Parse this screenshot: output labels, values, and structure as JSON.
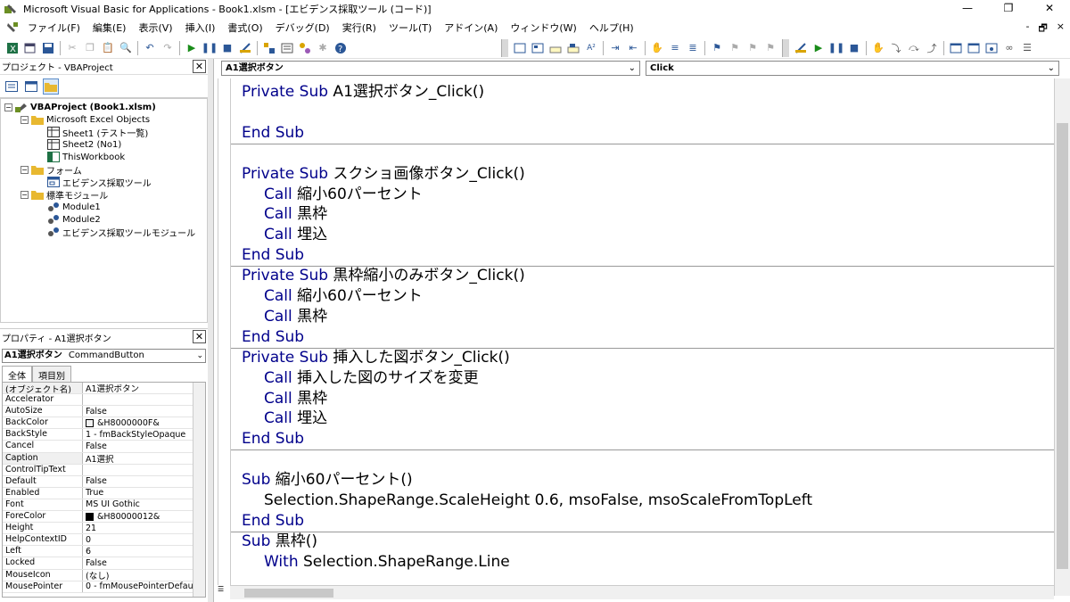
{
  "window": {
    "title": "Microsoft Visual Basic for Applications - Book1.xlsm - [エビデンス採取ツール (コード)]",
    "controls": [
      "—",
      "❐",
      "✕"
    ]
  },
  "menubar": {
    "items": [
      "ファイル(F)",
      "編集(E)",
      "表示(V)",
      "挿入(I)",
      "書式(O)",
      "デバッグ(D)",
      "実行(R)",
      "ツール(T)",
      "アドイン(A)",
      "ウィンドウ(W)",
      "ヘルプ(H)"
    ],
    "mdi_controls": [
      "-",
      "🗗",
      "×"
    ]
  },
  "project_pane": {
    "title": "プロジェクト - VBAProject",
    "tree": [
      {
        "label": "VBAProject (Book1.xlsm)",
        "level": 0,
        "expander": "−",
        "icon": "vba-project-icon",
        "bold": true
      },
      {
        "label": "Microsoft Excel Objects",
        "level": 1,
        "expander": "−",
        "icon": "folder-icon"
      },
      {
        "label": "Sheet1 (テスト一覧)",
        "level": 2,
        "icon": "sheet-icon"
      },
      {
        "label": "Sheet2 (No1)",
        "level": 2,
        "icon": "sheet-icon"
      },
      {
        "label": "ThisWorkbook",
        "level": 2,
        "icon": "workbook-icon"
      },
      {
        "label": "フォーム",
        "level": 1,
        "expander": "−",
        "icon": "folder-icon"
      },
      {
        "label": "エビデンス採取ツール",
        "level": 2,
        "icon": "userform-icon"
      },
      {
        "label": "標準モジュール",
        "level": 1,
        "expander": "−",
        "icon": "folder-icon"
      },
      {
        "label": "Module1",
        "level": 2,
        "icon": "module-icon"
      },
      {
        "label": "Module2",
        "level": 2,
        "icon": "module-icon"
      },
      {
        "label": "エビデンス採取ツールモジュール",
        "level": 2,
        "icon": "module-icon"
      }
    ]
  },
  "properties_pane": {
    "title": "プロパティ - A1選択ボタン",
    "object_select": {
      "name": "A1選択ボタン",
      "type": "CommandButton"
    },
    "tabs": [
      "全体",
      "項目別"
    ],
    "rows": [
      {
        "name": "(オブジェクト名)",
        "value": "A1選択ボタン"
      },
      {
        "name": "Accelerator",
        "value": ""
      },
      {
        "name": "AutoSize",
        "value": "False"
      },
      {
        "name": "BackColor",
        "value": "&H8000000F&",
        "swatch": "#f0f0f0"
      },
      {
        "name": "BackStyle",
        "value": "1 - fmBackStyleOpaque"
      },
      {
        "name": "Cancel",
        "value": "False"
      },
      {
        "name": "Caption",
        "value": "A1選択"
      },
      {
        "name": "ControlTipText",
        "value": ""
      },
      {
        "name": "Default",
        "value": "False"
      },
      {
        "name": "Enabled",
        "value": "True"
      },
      {
        "name": "Font",
        "value": "MS UI Gothic"
      },
      {
        "name": "ForeColor",
        "value": "&H80000012&",
        "swatch": "#000000"
      },
      {
        "name": "Height",
        "value": "21"
      },
      {
        "name": "HelpContextID",
        "value": "0"
      },
      {
        "name": "Left",
        "value": "6"
      },
      {
        "name": "Locked",
        "value": "False"
      },
      {
        "name": "MouseIcon",
        "value": "(なし)"
      },
      {
        "name": "MousePointer",
        "value": "0 - fmMousePointerDefau"
      }
    ]
  },
  "code_window": {
    "object_combo": "A1選択ボタン",
    "procedure_combo": "Click",
    "lines": [
      {
        "kw": "Private Sub",
        "text": " A1選択ボタン_Click()",
        "indent": 0
      },
      {
        "kw": "",
        "text": "",
        "indent": 0
      },
      {
        "kw": "End Sub",
        "text": "",
        "indent": 0,
        "sep_after": true
      },
      {
        "kw": "",
        "text": "",
        "indent": 0
      },
      {
        "kw": "Private Sub",
        "text": " スクショ画像ボタン_Click()",
        "indent": 0
      },
      {
        "kw": "Call",
        "text": " 縮小60パーセント",
        "indent": 1
      },
      {
        "kw": "Call",
        "text": " 黒枠",
        "indent": 1
      },
      {
        "kw": "Call",
        "text": " 埋込",
        "indent": 1
      },
      {
        "kw": "End Sub",
        "text": "",
        "indent": 0,
        "sep_after": true
      },
      {
        "kw": "Private Sub",
        "text": " 黒枠縮小のみボタン_Click()",
        "indent": 0
      },
      {
        "kw": "Call",
        "text": " 縮小60パーセント",
        "indent": 1
      },
      {
        "kw": "Call",
        "text": " 黒枠",
        "indent": 1
      },
      {
        "kw": "End Sub",
        "text": "",
        "indent": 0,
        "sep_after": true
      },
      {
        "kw": "Private Sub",
        "text": " 挿入した図ボタン_Click()",
        "indent": 0
      },
      {
        "kw": "Call",
        "text": " 挿入した図のサイズを変更",
        "indent": 1
      },
      {
        "kw": "Call",
        "text": " 黒枠",
        "indent": 1
      },
      {
        "kw": "Call",
        "text": " 埋込",
        "indent": 1
      },
      {
        "kw": "End Sub",
        "text": "",
        "indent": 0,
        "sep_after": true
      },
      {
        "kw": "",
        "text": "",
        "indent": 0
      },
      {
        "kw": "Sub",
        "text": " 縮小60パーセント()",
        "indent": 0
      },
      {
        "kw": "",
        "text": "Selection.ShapeRange.ScaleHeight 0.6, msoFalse, msoScaleFromTopLeft",
        "indent": 1
      },
      {
        "kw": "End Sub",
        "text": "",
        "indent": 0,
        "sep_after": true
      },
      {
        "kw": "Sub",
        "text": " 黒枠()",
        "indent": 0
      },
      {
        "kw": "With",
        "text": " Selection.ShapeRange.Line",
        "indent": 1
      }
    ]
  },
  "colors": {
    "keyword": "#00008b",
    "selection_highlight": "#dbe9f7"
  }
}
